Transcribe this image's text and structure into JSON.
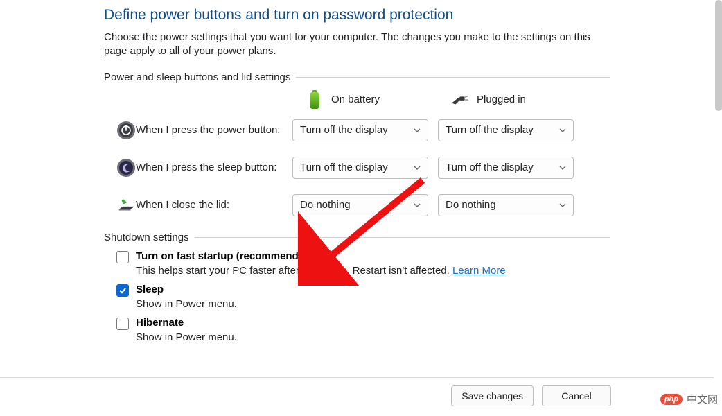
{
  "title": "Define power buttons and turn on password protection",
  "description": "Choose the power settings that you want for your computer. The changes you make to the settings on this page apply to all of your power plans.",
  "section1": "Power and sleep buttons and lid settings",
  "columns": {
    "battery": "On battery",
    "plugged": "Plugged in"
  },
  "rows": {
    "power": {
      "label": "When I press the power button:",
      "battery": "Turn off the display",
      "plugged": "Turn off the display"
    },
    "sleep": {
      "label": "When I press the sleep button:",
      "battery": "Turn off the display",
      "plugged": "Turn off the display"
    },
    "lid": {
      "label": "When I close the lid:",
      "battery": "Do nothing",
      "plugged": "Do nothing"
    }
  },
  "section2": "Shutdown settings",
  "shutdown": {
    "fast": {
      "label": "Turn on fast startup (recommended)",
      "sub": "This helps start your PC faster after shutdown. Restart isn't affected. ",
      "link": "Learn More",
      "checked": false
    },
    "sleep": {
      "label": "Sleep",
      "sub": "Show in Power menu.",
      "checked": true
    },
    "hiber": {
      "label": "Hibernate",
      "sub": "Show in Power menu.",
      "checked": false
    }
  },
  "buttons": {
    "save": "Save changes",
    "cancel": "Cancel"
  },
  "watermark": "中文网"
}
